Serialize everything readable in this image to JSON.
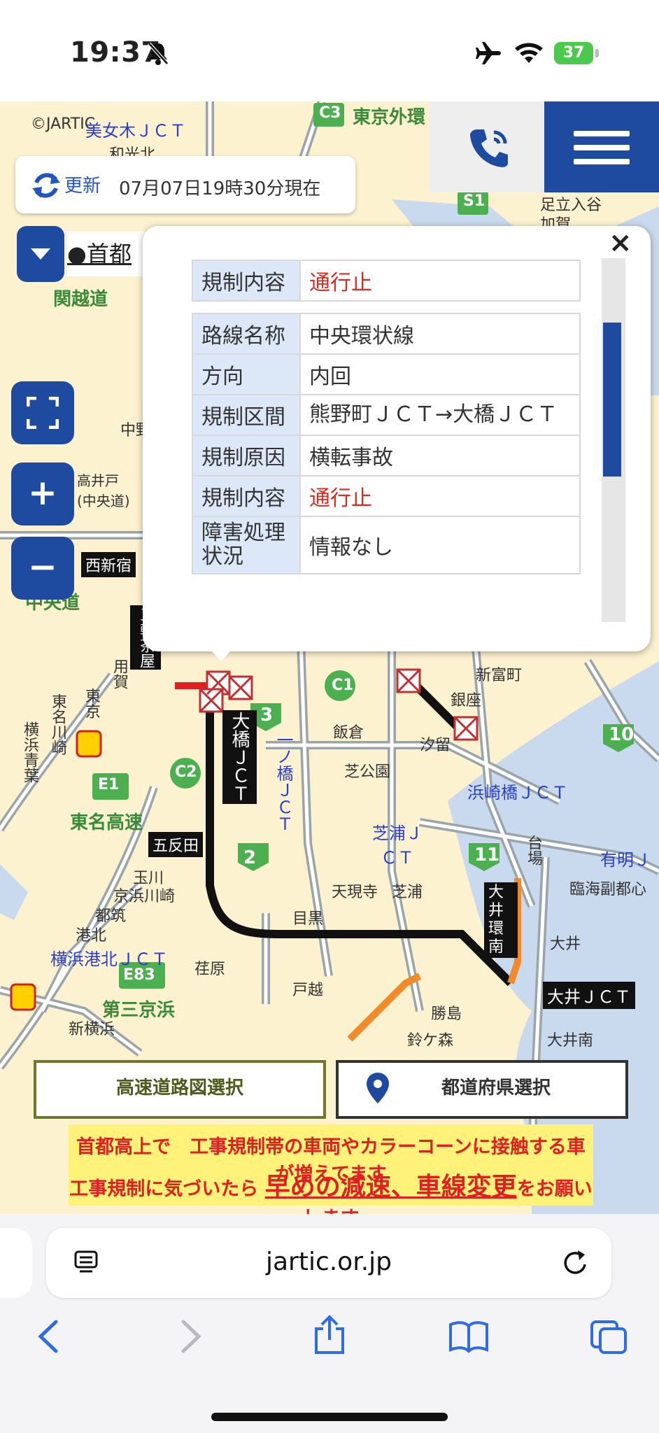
{
  "status_bar": {
    "time": "19:37",
    "battery": "37"
  },
  "map": {
    "copyright": "©JARTIC",
    "refresh": {
      "label": "更新",
      "timestamp": "07月07日19時30分現在"
    },
    "route_selector_label": "●首都",
    "labels": {
      "tokyo_gaikan": "東京外環",
      "c3": "C3",
      "bijogi_jct": "美女木ＪＣＴ",
      "wakoukita": "和光北",
      "kanetsudo": "関越道",
      "s1": "S1",
      "adachi_iriya": "足立入谷",
      "kaga": "加賀",
      "takaido": "高井戸\n(中央道)",
      "nakano": "中野",
      "nishishinjuku": "西新宿",
      "chuodo": "中央道",
      "sangenjaya": "三軒茶屋",
      "yoga": "用賀",
      "tomei_kawasaki": "東名川崎",
      "yokohama_aoba": "横浜青葉",
      "tokyo": "東京",
      "e1": "E1",
      "tomei": "東名高速",
      "c2": "C2",
      "gotanda": "五反田",
      "ohashi_jct": "大橋ＪＣＴ",
      "r3": "3",
      "ichinohashi_jct": "一ノ橋ＪＣＴ",
      "c1": "C1",
      "iikura": "飯倉",
      "ginza": "銀座",
      "shiodome": "汐留",
      "shintomicho": "新富町",
      "shibakoen": "芝公園",
      "r10": "10",
      "hamazakibashi_jct": "浜崎橋ＪＣＴ",
      "shibaura_jct": "芝浦ＪＣＴ",
      "r11": "11",
      "daiba": "台場",
      "ariake": "有明Ｊ",
      "rinkai": "臨海副都心",
      "r2": "2",
      "tengenji": "天現寺",
      "shibaura": "芝浦",
      "oi_loop": "大井環南",
      "tamagawa": "玉川",
      "kyohin_kawasaki": "京浜川崎",
      "tsuzuki": "都筑",
      "kohoku": "港北",
      "meguro": "目黒",
      "oi": "大井",
      "yokohama_kohoku_jct": "横浜港北ＪＣＴ",
      "ebara": "荏原",
      "togoshi": "戸越",
      "oi_jct": "大井ＪＣＴ",
      "e83": "E83",
      "daisan_keihin": "第三京浜",
      "katsushima": "勝島",
      "suzugamori": "鈴ケ森",
      "oiminami": "大井南",
      "shinyokohama": "新横浜"
    },
    "popup": {
      "section1": [
        {
          "key": "規制内容",
          "value": "通行止",
          "highlight": true
        }
      ],
      "section2": [
        {
          "key": "路線名称",
          "value": "中央環状線",
          "highlight": false
        },
        {
          "key": "方向",
          "value": "内回",
          "highlight": false
        },
        {
          "key": "規制区間",
          "value": "熊野町ＪＣＴ→大橋ＪＣＴ",
          "highlight": false
        },
        {
          "key": "規制原因",
          "value": "横転事故",
          "highlight": false
        },
        {
          "key": "規制内容",
          "value": "通行止",
          "highlight": true
        },
        {
          "key": "障害処理状況",
          "value": "情報なし",
          "highlight": false
        }
      ],
      "close_symbol": "×"
    },
    "buttons": {
      "highway_map": "高速道路図選択",
      "prefecture": "都道府県選択"
    },
    "banner": {
      "line1": "首都高上で　工事規制帯の車両やカラーコーンに接触する車が増えてます",
      "line2_pre": "工事規制に気づいたら",
      "line2_emph": "早めの減速、車線変更",
      "line2_post": "をお願いします"
    }
  },
  "browser": {
    "url": "jartic.or.jp"
  }
}
